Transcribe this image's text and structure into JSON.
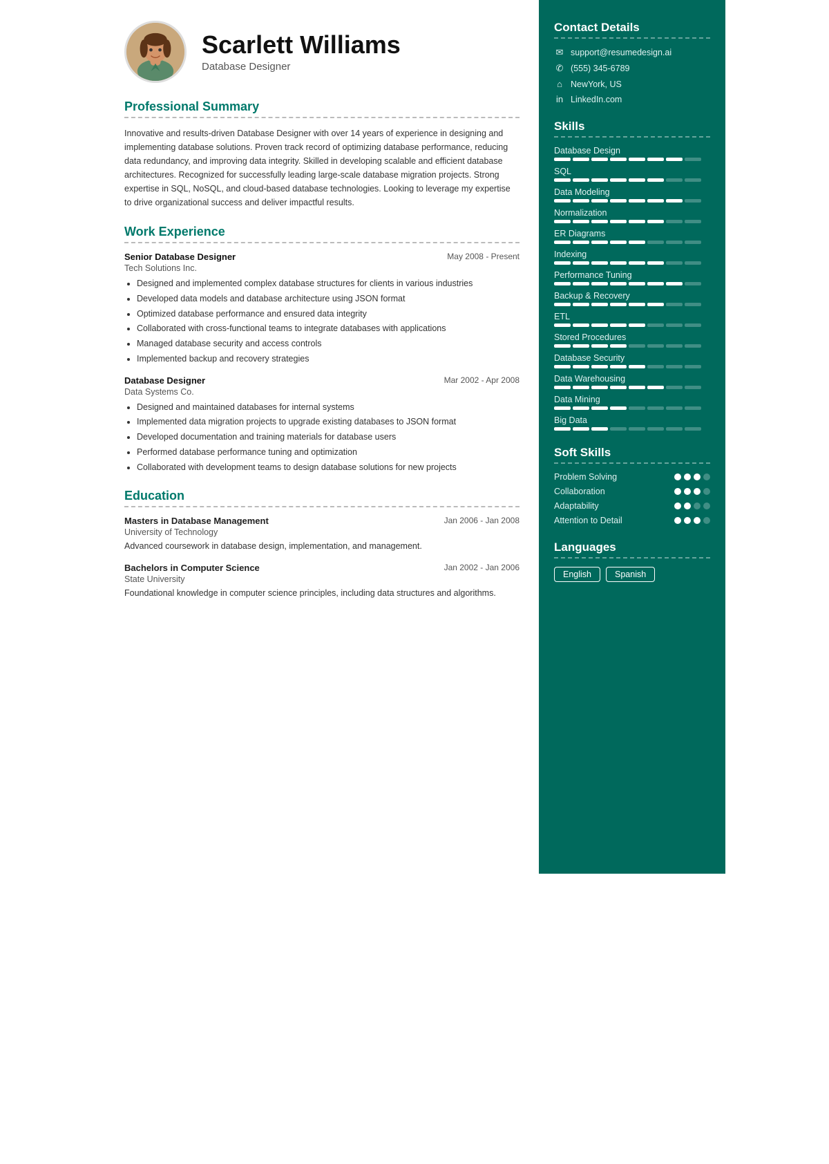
{
  "header": {
    "name": "Scarlett Williams",
    "title": "Database Designer"
  },
  "contact": {
    "section_title": "Contact Details",
    "items": [
      {
        "icon": "✉",
        "text": "support@resumedesign.ai"
      },
      {
        "icon": "✆",
        "text": "(555) 345-6789"
      },
      {
        "icon": "⌂",
        "text": "NewYork, US"
      },
      {
        "icon": "in",
        "text": "LinkedIn.com"
      }
    ]
  },
  "summary": {
    "section_title": "Professional Summary",
    "text": "Innovative and results-driven Database Designer with over 14 years of experience in designing and implementing database solutions. Proven track record of optimizing database performance, reducing data redundancy, and improving data integrity. Skilled in developing scalable and efficient database architectures. Recognized for successfully leading large-scale database migration projects. Strong expertise in SQL, NoSQL, and cloud-based database technologies. Looking to leverage my expertise to drive organizational success and deliver impactful results."
  },
  "skills": {
    "section_title": "Skills",
    "items": [
      {
        "name": "Database Design",
        "filled": 7,
        "total": 8
      },
      {
        "name": "SQL",
        "filled": 6,
        "total": 8
      },
      {
        "name": "Data Modeling",
        "filled": 7,
        "total": 8
      },
      {
        "name": "Normalization",
        "filled": 6,
        "total": 8
      },
      {
        "name": "ER Diagrams",
        "filled": 5,
        "total": 8
      },
      {
        "name": "Indexing",
        "filled": 6,
        "total": 8
      },
      {
        "name": "Performance Tuning",
        "filled": 7,
        "total": 8
      },
      {
        "name": "Backup & Recovery",
        "filled": 6,
        "total": 8
      },
      {
        "name": "ETL",
        "filled": 5,
        "total": 8
      },
      {
        "name": "Stored Procedures",
        "filled": 4,
        "total": 8
      },
      {
        "name": "Database Security",
        "filled": 5,
        "total": 8
      },
      {
        "name": "Data Warehousing",
        "filled": 6,
        "total": 8
      },
      {
        "name": "Data Mining",
        "filled": 4,
        "total": 8
      },
      {
        "name": "Big Data",
        "filled": 3,
        "total": 8
      }
    ]
  },
  "soft_skills": {
    "section_title": "Soft Skills",
    "items": [
      {
        "name": "Problem Solving",
        "filled": 3,
        "total": 4
      },
      {
        "name": "Collaboration",
        "filled": 3,
        "total": 4
      },
      {
        "name": "Adaptability",
        "filled": 2,
        "total": 4
      },
      {
        "name": "Attention to Detail",
        "filled": 3,
        "total": 4
      }
    ]
  },
  "languages": {
    "section_title": "Languages",
    "items": [
      "English",
      "Spanish"
    ]
  },
  "work_experience": {
    "section_title": "Work Experience",
    "jobs": [
      {
        "title": "Senior Database Designer",
        "company": "Tech Solutions Inc.",
        "date": "May 2008 - Present",
        "bullets": [
          "Designed and implemented complex database structures for clients in various industries",
          "Developed data models and database architecture using JSON format",
          "Optimized database performance and ensured data integrity",
          "Collaborated with cross-functional teams to integrate databases with applications",
          "Managed database security and access controls",
          "Implemented backup and recovery strategies"
        ]
      },
      {
        "title": "Database Designer",
        "company": "Data Systems Co.",
        "date": "Mar 2002 - Apr 2008",
        "bullets": [
          "Designed and maintained databases for internal systems",
          "Implemented data migration projects to upgrade existing databases to JSON format",
          "Developed documentation and training materials for database users",
          "Performed database performance tuning and optimization",
          "Collaborated with development teams to design database solutions for new projects"
        ]
      }
    ]
  },
  "education": {
    "section_title": "Education",
    "items": [
      {
        "degree": "Masters in Database Management",
        "school": "University of Technology",
        "date": "Jan 2006 - Jan 2008",
        "desc": "Advanced coursework in database design, implementation, and management."
      },
      {
        "degree": "Bachelors in Computer Science",
        "school": "State University",
        "date": "Jan 2002 - Jan 2006",
        "desc": "Foundational knowledge in computer science principles, including data structures and algorithms."
      }
    ]
  }
}
